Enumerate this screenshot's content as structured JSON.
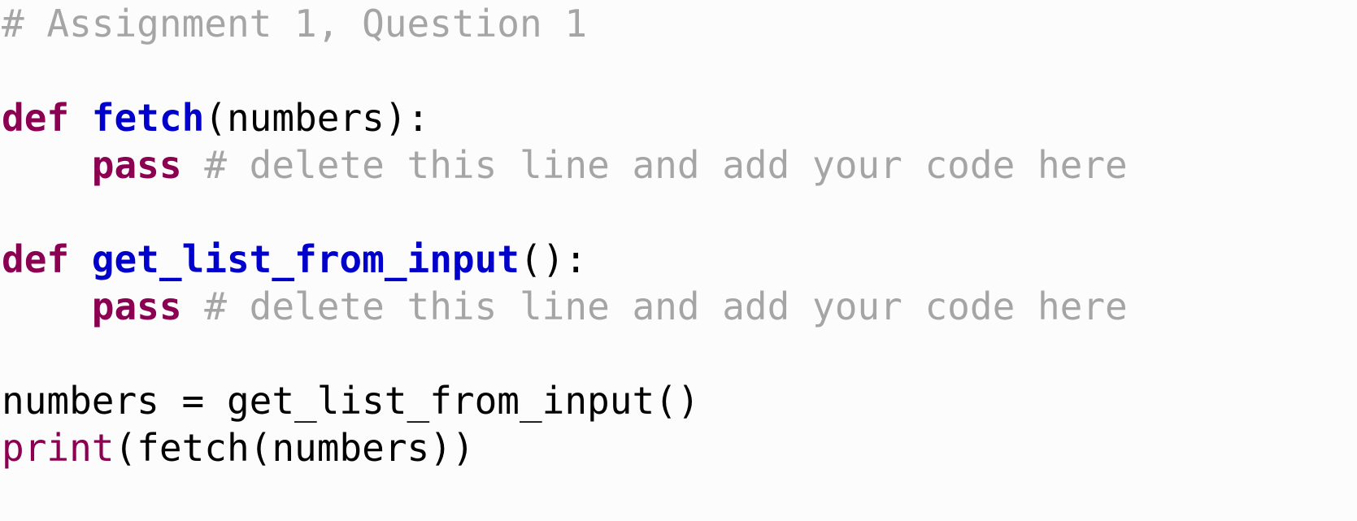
{
  "editor": {
    "language": "python",
    "background_color": "#fcfcfc",
    "syntax_colors": {
      "comment": "#a5a5a5",
      "keyword": "#8b0050",
      "function_name": "#0000cc",
      "builtin": "#8b0050",
      "plain": "#000000"
    }
  },
  "code": {
    "lines": [
      {
        "blank": false,
        "tokens": [
          {
            "text": "# Assignment 1, Question 1",
            "type": "comment"
          }
        ]
      },
      {
        "blank": true,
        "tokens": []
      },
      {
        "blank": false,
        "tokens": [
          {
            "text": "def",
            "type": "keyword"
          },
          {
            "text": " ",
            "type": "plain"
          },
          {
            "text": "fetch",
            "type": "funcname"
          },
          {
            "text": "(numbers):",
            "type": "plain"
          }
        ]
      },
      {
        "blank": false,
        "tokens": [
          {
            "text": "    ",
            "type": "plain"
          },
          {
            "text": "pass",
            "type": "keyword"
          },
          {
            "text": " ",
            "type": "plain"
          },
          {
            "text": "# delete this line and add your code here",
            "type": "comment"
          }
        ]
      },
      {
        "blank": true,
        "tokens": []
      },
      {
        "blank": false,
        "tokens": [
          {
            "text": "def",
            "type": "keyword"
          },
          {
            "text": " ",
            "type": "plain"
          },
          {
            "text": "get_list_from_input",
            "type": "funcname"
          },
          {
            "text": "():",
            "type": "plain"
          }
        ]
      },
      {
        "blank": false,
        "tokens": [
          {
            "text": "    ",
            "type": "plain"
          },
          {
            "text": "pass",
            "type": "keyword"
          },
          {
            "text": " ",
            "type": "plain"
          },
          {
            "text": "# delete this line and add your code here",
            "type": "comment"
          }
        ]
      },
      {
        "blank": true,
        "tokens": []
      },
      {
        "blank": false,
        "tokens": [
          {
            "text": "numbers = get_list_from_input()",
            "type": "plain"
          }
        ]
      },
      {
        "blank": false,
        "tokens": [
          {
            "text": "print",
            "type": "builtin"
          },
          {
            "text": "(fetch(numbers))",
            "type": "plain"
          }
        ]
      }
    ]
  }
}
